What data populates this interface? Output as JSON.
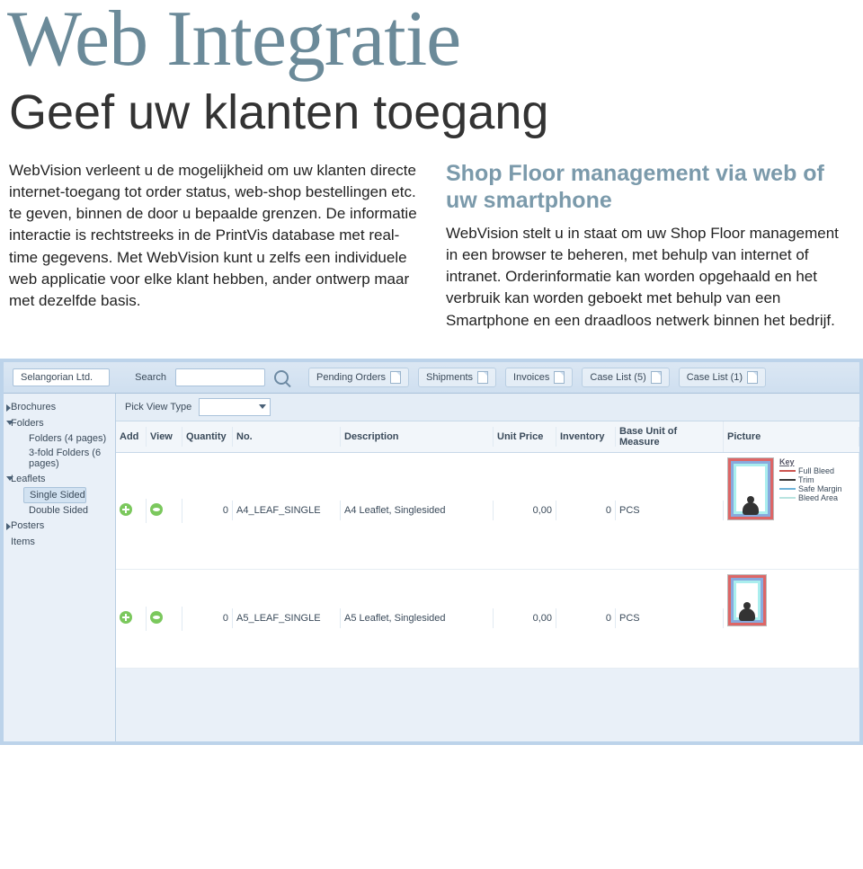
{
  "title": "Web Integratie",
  "subtitle": "Geef uw klanten toegang",
  "left_para": "WebVision verleent u de mogelijkheid om uw klanten directe internet-toegang tot order status, web-shop bestellingen etc. te geven, binnen de door u bepaalde grenzen. De informatie interactie is rechtstreeks in de PrintVis database met real-time gegevens. Met WebVision kunt u zelfs een individuele web applicatie voor elke klant hebben, ander ontwerp maar met dezelfde basis.",
  "right_heading": "Shop Floor management via web of uw smartphone",
  "right_para": "WebVision stelt u in staat om uw Shop Floor management in een browser te beheren, met behulp van internet of intranet. Orderinformatie kan worden opgehaald en het verbruik kan worden geboekt met behulp van een Smartphone en een draadloos netwerk binnen het bedrijf.",
  "app": {
    "company": "Selangorian Ltd.",
    "search_label": "Search",
    "tabs": [
      "Pending Orders",
      "Shipments",
      "Invoices",
      "Case List (5)",
      "Case List (1)"
    ],
    "filter_label": "Pick View Type",
    "sidebar": {
      "brochures": "Brochures",
      "folders": "Folders",
      "folders_children": [
        "Folders (4 pages)",
        "3-fold Folders (6 pages)"
      ],
      "leaflets": "Leaflets",
      "leaflets_children": [
        "Single Sided",
        "Double Sided"
      ],
      "posters": "Posters",
      "items": "Items"
    },
    "grid": {
      "headers": [
        "Add",
        "View",
        "Quantity",
        "No.",
        "Description",
        "Unit Price",
        "Inventory",
        "Base Unit of Measure",
        "Picture"
      ],
      "rows": [
        {
          "qty": "0",
          "no": "A4_LEAF_SINGLE",
          "desc": "A4 Leaflet, Singlesided",
          "price": "0,00",
          "inv": "0",
          "uom": "PCS"
        },
        {
          "qty": "0",
          "no": "A5_LEAF_SINGLE",
          "desc": "A5 Leaflet, Singlesided",
          "price": "0,00",
          "inv": "0",
          "uom": "PCS"
        }
      ],
      "key": {
        "title": "Key",
        "items": [
          {
            "label": "Full Bleed",
            "color": "#cc5550"
          },
          {
            "label": "Trim",
            "color": "#3a3a3a"
          },
          {
            "label": "Safe Margin",
            "color": "#6fb4d9"
          },
          {
            "label": "Bleed Area",
            "color": "#b9e4e0"
          }
        ]
      }
    }
  }
}
